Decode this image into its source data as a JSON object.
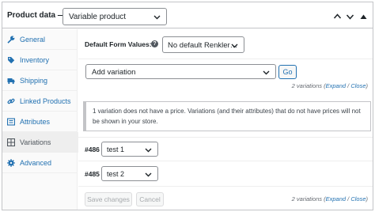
{
  "header": {
    "title": "Product data —",
    "product_type": "Variable product",
    "move_up_icon": "chevron-up-icon",
    "move_down_icon": "chevron-down-icon",
    "toggle_icon": "triangle-up-icon"
  },
  "sidebar": {
    "items": [
      {
        "label": "General",
        "icon": "wrench-icon"
      },
      {
        "label": "Inventory",
        "icon": "tag-icon"
      },
      {
        "label": "Shipping",
        "icon": "truck-icon"
      },
      {
        "label": "Linked Products",
        "icon": "link-icon"
      },
      {
        "label": "Attributes",
        "icon": "list-icon"
      },
      {
        "label": "Variations",
        "icon": "grid-icon",
        "active": true
      },
      {
        "label": "Advanced",
        "icon": "gear-icon"
      }
    ]
  },
  "main": {
    "default_form_values_label": "Default Form Values:",
    "default_form_value": "No default Renkler…",
    "add_variation_select": "Add variation",
    "go_label": "Go",
    "variations_count_prefix": "2 variations (",
    "expand_label": "Expand",
    "separator": " / ",
    "close_label": "Close",
    "variations_count_suffix": ")",
    "notice_text": "1 variation does not have a price. Variations (and their attributes) that do not have prices will not be shown in your store.",
    "variations": [
      {
        "id": "#486",
        "value": "test 1"
      },
      {
        "id": "#485",
        "value": "test 2"
      }
    ],
    "save_changes_label": "Save changes",
    "cancel_label": "Cancel"
  }
}
